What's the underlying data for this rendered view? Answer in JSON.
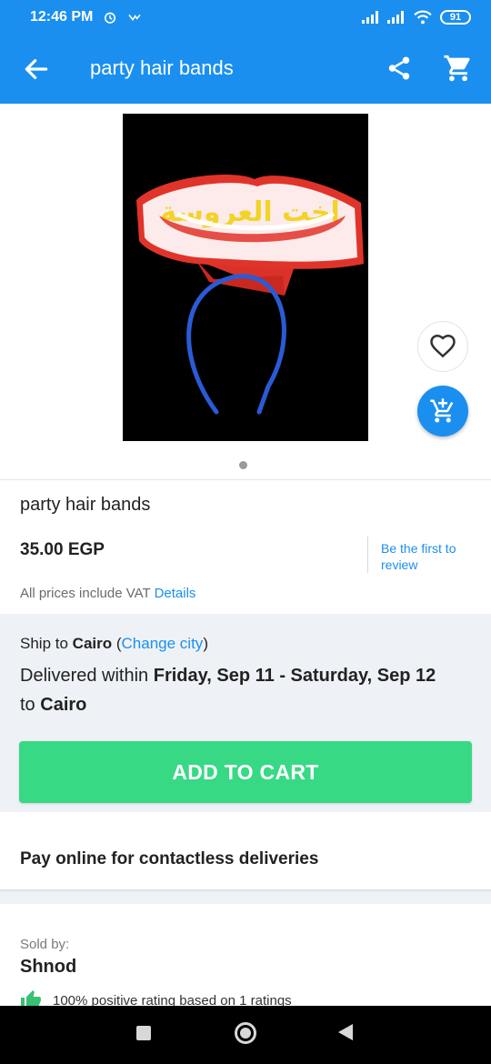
{
  "status_bar": {
    "time": "12:46 PM",
    "battery": "91",
    "icons": [
      "alarm-icon",
      "check-icon",
      "signal-icon",
      "signal-icon",
      "wifi-icon",
      "battery-icon"
    ]
  },
  "app_bar": {
    "title": "party hair bands",
    "icons": [
      "back-arrow-icon",
      "share-icon",
      "cart-icon"
    ]
  },
  "product": {
    "image_alt": "Party headband with red and yellow Arabic lettering on a blue band",
    "headband_text": "اخت العروسة",
    "name": "party hair bands",
    "price": "35.00 EGP",
    "review_link": "Be the first to review",
    "vat_text": "All prices include VAT",
    "vat_link": "Details",
    "carousel_dots": 1
  },
  "shipping": {
    "ship_prefix": "Ship to",
    "city": "Cairo",
    "change_city": "Change city",
    "delivered_prefix": "Delivered within",
    "date_range": "Friday, Sep 11 - Saturday, Sep 12",
    "to_label": "to",
    "to_city": "Cairo"
  },
  "actions": {
    "add_to_cart": "ADD TO CART"
  },
  "promo": {
    "pay_online": "Pay online for contactless deliveries"
  },
  "seller": {
    "sold_by_label": "Sold by:",
    "name": "Shnod",
    "rating_text": "100% positive rating based on 1 ratings"
  },
  "colors": {
    "primary": "#1a8ff0",
    "cta": "#38d985",
    "text": "#222222",
    "muted": "#6b6b6b",
    "panel": "#eef2f6"
  }
}
